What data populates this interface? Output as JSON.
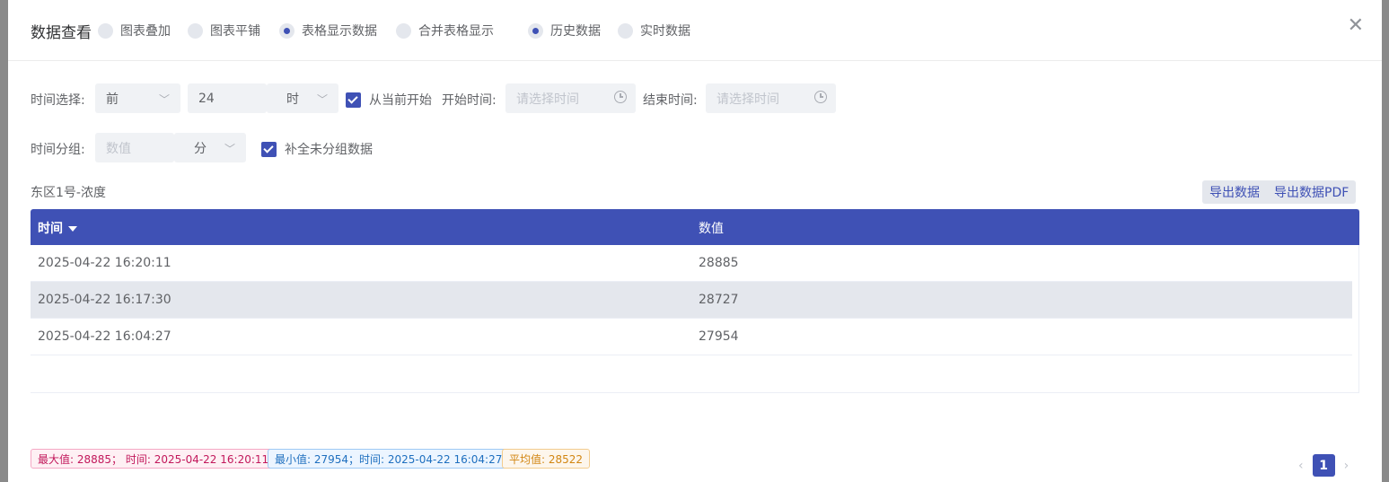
{
  "header": {
    "title": "数据查看",
    "view_options": [
      {
        "label": "图表叠加",
        "checked": false
      },
      {
        "label": "图表平铺",
        "checked": false
      },
      {
        "label": "表格显示数据",
        "checked": true
      },
      {
        "label": "合并表格显示",
        "checked": false
      }
    ],
    "source_options": [
      {
        "label": "历史数据",
        "checked": true
      },
      {
        "label": "实时数据",
        "checked": false
      }
    ],
    "close_icon": "close-icon"
  },
  "filters": {
    "time_select_label": "时间选择:",
    "direction_value": "前",
    "amount_value": "24",
    "unit_value": "时",
    "from_now_label": "从当前开始",
    "from_now_checked": true,
    "start_label": "开始时间:",
    "start_placeholder": "请选择时间",
    "end_label": "结束时间:",
    "end_placeholder": "请选择时间",
    "group_label": "时间分组:",
    "group_placeholder": "数值",
    "group_unit": "分",
    "fill_label": "补全未分组数据",
    "fill_checked": true
  },
  "table": {
    "title": "东区1号-浓度",
    "export_label": "导出数据",
    "export_pdf_label": "导出数据PDF",
    "columns": [
      "时间",
      "数值"
    ],
    "rows": [
      {
        "time": "2025-04-22 16:20:11",
        "value": "28885"
      },
      {
        "time": "2025-04-22 16:17:30",
        "value": "28727"
      },
      {
        "time": "2025-04-22 16:04:27",
        "value": "27954"
      }
    ]
  },
  "stats": {
    "max": "最大值: 28885； 时间: 2025-04-22 16:20:11",
    "min": "最小值: 27954；时间: 2025-04-22 16:04:27",
    "avg": "平均值: 28522"
  },
  "pagination": {
    "current": "1",
    "prev": "‹",
    "next": "›"
  },
  "colors": {
    "accent": "#3f51b5",
    "max_tag": "#c2185b",
    "min_tag": "#1e6fbf",
    "avg_tag": "#d28612"
  }
}
